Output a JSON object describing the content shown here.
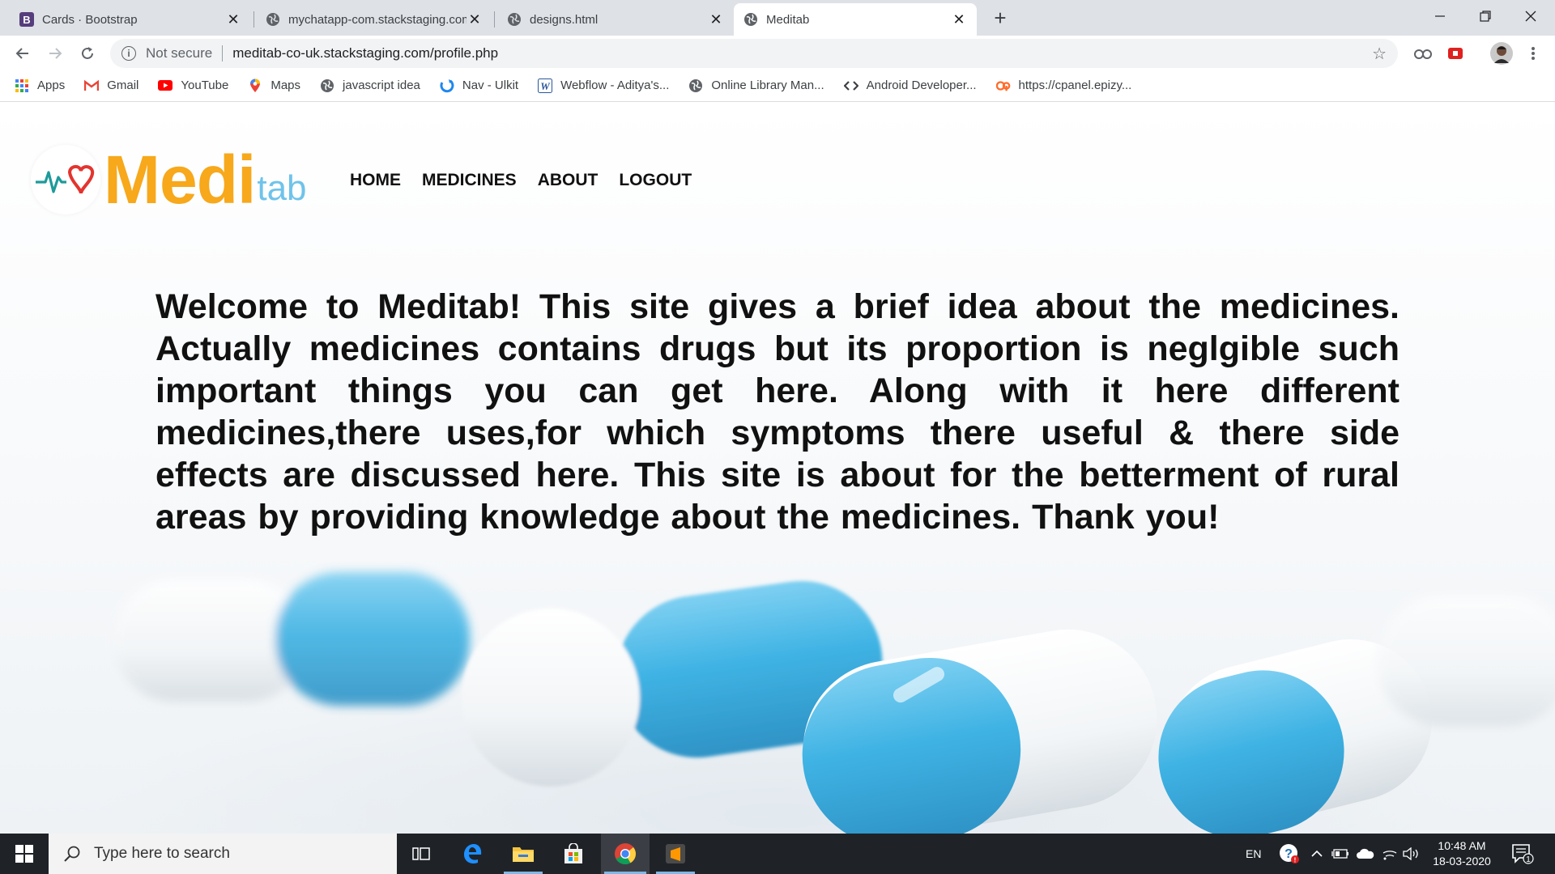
{
  "browser": {
    "tabs": [
      {
        "title": "Cards · Bootstrap",
        "icon": "bootstrap-icon"
      },
      {
        "title": "mychatapp-com.stackstaging.com",
        "icon": "globe-icon"
      },
      {
        "title": "designs.html",
        "icon": "globe-icon"
      },
      {
        "title": "Meditab",
        "icon": "globe-icon",
        "active": true
      }
    ],
    "security_label": "Not secure",
    "url": "meditab-co-uk.stackstaging.com/profile.php",
    "bookmarks": [
      {
        "label": "Apps",
        "icon": "apps-grid-icon"
      },
      {
        "label": "Gmail",
        "icon": "gmail-icon"
      },
      {
        "label": "YouTube",
        "icon": "youtube-icon"
      },
      {
        "label": "Maps",
        "icon": "maps-pin-icon"
      },
      {
        "label": "javascript idea",
        "icon": "globe-icon"
      },
      {
        "label": "Nav - Ulkit",
        "icon": "uikit-icon"
      },
      {
        "label": "Webflow - Aditya's...",
        "icon": "webflow-icon"
      },
      {
        "label": "Online Library Man...",
        "icon": "globe-icon"
      },
      {
        "label": "Android Developer...",
        "icon": "code-icon"
      },
      {
        "label": "https://cpanel.epizy...",
        "icon": "cpanel-icon"
      }
    ]
  },
  "page": {
    "logo": {
      "part1": "Medi",
      "part2": "tab"
    },
    "nav": [
      "HOME",
      "MEDICINES",
      "ABOUT",
      "LOGOUT"
    ],
    "welcome": "Welcome to Meditab! This site gives a brief idea about the medicines. Actually medicines contains drugs but its proportion is neglgible such important things you can get here. Along with it here different medicines,there uses,for which symptoms there useful & there side effects are discussed here. This site is about for the betterment of rural areas by providing knowledge about the medicines. Thank you!"
  },
  "taskbar": {
    "search_placeholder": "Type here to search",
    "language": "EN",
    "time": "10:48 AM",
    "date": "18-03-2020",
    "notification_count": "1"
  },
  "colors": {
    "logo_orange": "#f7a81b",
    "logo_blue": "#6fc3ea",
    "capsule_blue": "#3fb3e4"
  }
}
